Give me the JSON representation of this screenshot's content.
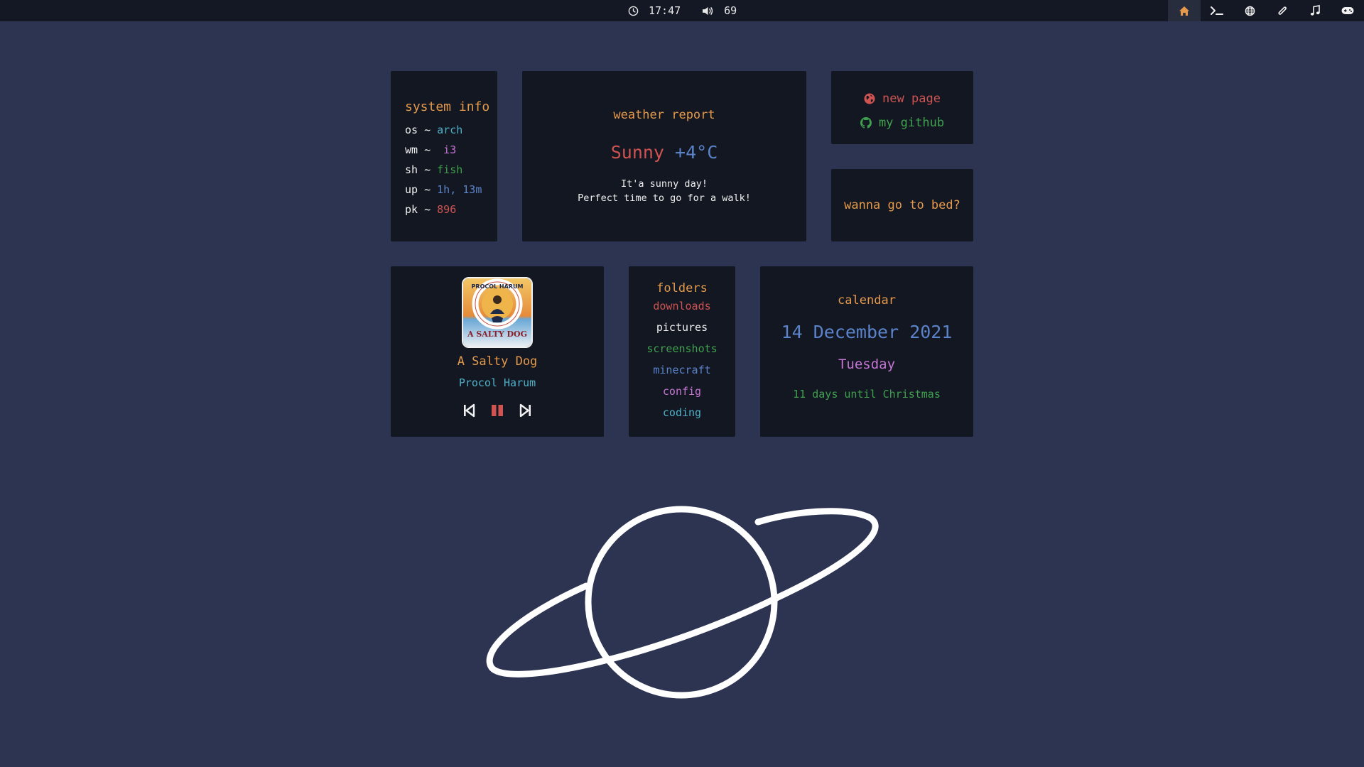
{
  "topbar": {
    "clock_icon": "clock-icon",
    "time": "17:47",
    "volume_icon": "volume-icon",
    "volume": "69",
    "tabs": [
      {
        "icon": "home-icon",
        "active": true
      },
      {
        "icon": "terminal-icon",
        "active": false
      },
      {
        "icon": "globe-icon",
        "active": false
      },
      {
        "icon": "paperclip-icon",
        "active": false
      },
      {
        "icon": "music-note-icon",
        "active": false
      },
      {
        "icon": "gamepad-icon",
        "active": false
      }
    ],
    "active_color": "#e59a4b"
  },
  "sysinfo": {
    "heading": "system info",
    "rows": [
      {
        "key": "os ~ ",
        "value": "arch"
      },
      {
        "key": "wm ~ ",
        "value": " i3"
      },
      {
        "key": "sh ~ ",
        "value": "fish"
      },
      {
        "key": "up ~ ",
        "value": "1h, 13m"
      },
      {
        "key": "pk ~ ",
        "value": "896"
      }
    ]
  },
  "weather": {
    "heading": "weather report",
    "condition": "Sunny",
    "temperature": "+4°C",
    "line1": "It'a sunny day!",
    "line2": "Perfect time to go for a walk!"
  },
  "links": {
    "new_page": "new page",
    "new_page_icon": "globe-icon",
    "github": "my github",
    "github_icon": "github-icon"
  },
  "bed": {
    "label": "wanna go to bed?"
  },
  "music": {
    "album_art": "album-cover-icon",
    "album_art_text_top": "PROCOL HARUM",
    "album_art_text_bottom": "A SALTY DOG",
    "song": "A Salty Dog",
    "artist": "Procol Harum",
    "state": "playing"
  },
  "folders": {
    "heading": "folders",
    "items": [
      "downloads",
      "pictures",
      "screenshots",
      "minecraft",
      "config",
      "coding"
    ]
  },
  "calendar": {
    "heading": "calendar",
    "date": "14 December 2021",
    "day": "Tuesday",
    "countdown": "11 days until Christmas"
  },
  "colors": {
    "background": "#2d3452",
    "card": "#131722",
    "orange": "#e59a4b",
    "cyan": "#4fb1c7",
    "purple": "#c574d3",
    "green": "#3fa14d",
    "blue": "#5b83c9",
    "red": "#cf5350"
  }
}
